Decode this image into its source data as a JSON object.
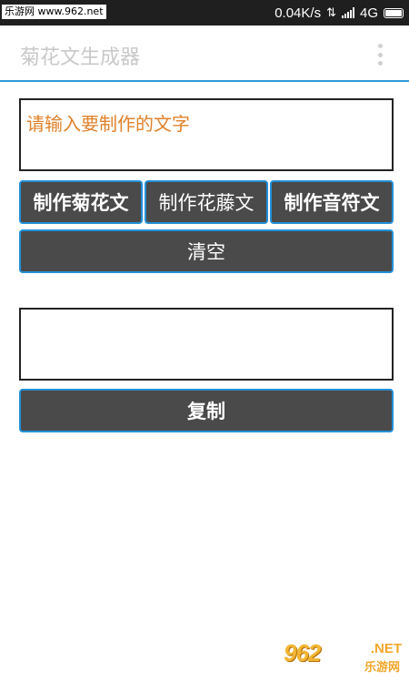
{
  "status_bar": {
    "watermark": "乐游网 www.962.net",
    "network_speed": "0.04K/s",
    "network_type": "4G",
    "background_color": "#1f1f1f"
  },
  "action_bar": {
    "title": "菊花文生成器",
    "accent_color": "#2d9ad8"
  },
  "input": {
    "value": "请输入要制作的文字",
    "text_color": "#e0822b"
  },
  "buttons": {
    "juhua": "制作菊花文",
    "huateng": "制作花藤文",
    "yinfu": "制作音符文",
    "clear": "清空",
    "copy": "复制"
  },
  "output": {
    "value": ""
  },
  "watermark_bottom": {
    "logo": "962",
    "net": ".NET",
    "cn": "乐游网"
  },
  "colors": {
    "button_bg": "#4a4a4a",
    "button_border": "#2390d8"
  }
}
